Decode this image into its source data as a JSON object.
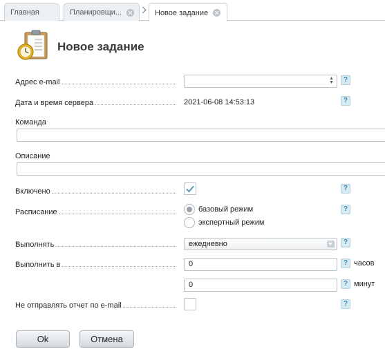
{
  "tabs": [
    {
      "label": "Главная"
    },
    {
      "label": "Планировщи..."
    },
    {
      "label": "Новое задание"
    }
  ],
  "icons": {
    "tab_close": "close-circle-icon",
    "tab_nav": "chevron-right-icon",
    "page": "clipboard-clock-icon",
    "help": "help-icon"
  },
  "page": {
    "title": "Новое задание"
  },
  "help_glyph": "?",
  "form": {
    "email": {
      "label": "Адрес e-mail",
      "value": ""
    },
    "server_time": {
      "label": "Дата и время сервера",
      "value": "2021-06-08 14:53:13"
    },
    "command": {
      "label": "Команда",
      "value": ""
    },
    "description": {
      "label": "Описание",
      "value": ""
    },
    "enabled": {
      "label": "Включено",
      "checked": true
    },
    "schedule": {
      "label": "Расписание",
      "options": [
        {
          "label": "базовый режим",
          "selected": true
        },
        {
          "label": "экспертный режим",
          "selected": false
        }
      ]
    },
    "run": {
      "label": "Выполнять",
      "value": "ежедневно"
    },
    "run_at": {
      "label": "Выполнить в",
      "hours": {
        "value": "0",
        "unit": "часов"
      },
      "minutes": {
        "value": "0",
        "unit": "минут"
      }
    },
    "no_email_report": {
      "label": "Не отправлять отчет по e-mail",
      "checked": false
    }
  },
  "buttons": {
    "ok": "Ok",
    "cancel": "Отмена"
  },
  "colors": {
    "accent_check": "#5a93b5",
    "help_bg": "#d6eaf3",
    "help_fg": "#3d8bb0"
  }
}
